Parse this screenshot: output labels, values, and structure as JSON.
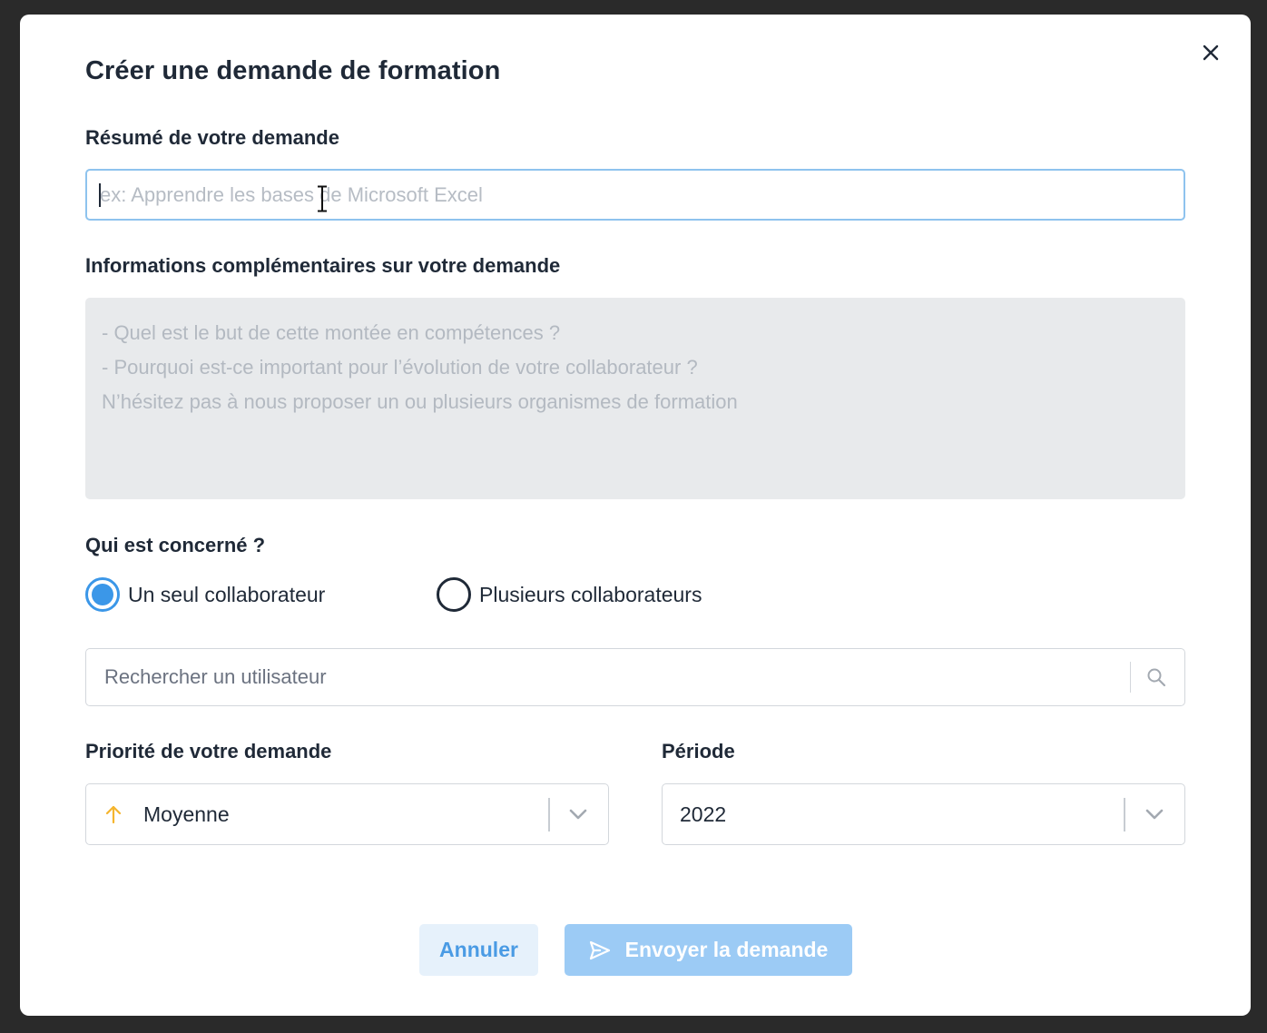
{
  "modal": {
    "title": "Créer une demande de formation"
  },
  "summary": {
    "label": "Résumé de votre demande",
    "placeholder": "ex: Apprendre les bases de Microsoft Excel",
    "value": ""
  },
  "details": {
    "label": "Informations complémentaires sur votre demande",
    "placeholder_lines": [
      "- Quel est le but de cette montée en compétences ?",
      "- Pourquoi est-ce important pour l’évolution de votre collaborateur ?",
      "N’hésitez pas à nous proposer un ou plusieurs organismes de formation"
    ]
  },
  "concerned": {
    "label": "Qui est concerné ?",
    "options": [
      {
        "label": "Un seul collaborateur",
        "checked": true
      },
      {
        "label": "Plusieurs collaborateurs",
        "checked": false
      }
    ]
  },
  "user_search": {
    "placeholder": "Rechercher un utilisateur"
  },
  "priority": {
    "label": "Priorité de votre demande",
    "value": "Moyenne",
    "icon": "arrow-up-icon",
    "icon_color": "#f5b52e"
  },
  "period": {
    "label": "Période",
    "value": "2022"
  },
  "actions": {
    "cancel_label": "Annuler",
    "send_label": "Envoyer la demande"
  },
  "colors": {
    "accent": "#3b97e8",
    "send_button": "#9ccbf5",
    "cancel_button": "#e6f1fb"
  }
}
